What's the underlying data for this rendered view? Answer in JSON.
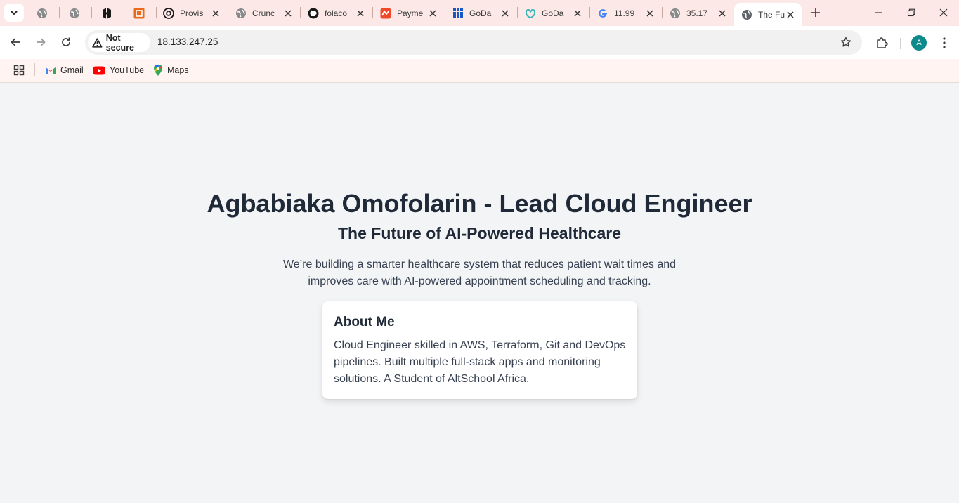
{
  "browser": {
    "tabs": [
      {
        "title": "",
        "icon": "globe-icon"
      },
      {
        "title": "",
        "icon": "globe-icon"
      },
      {
        "title": "",
        "icon": "hashicorp-icon"
      },
      {
        "title": "",
        "icon": "orange-box-icon"
      },
      {
        "title": "Provis",
        "icon": "openai-icon"
      },
      {
        "title": "Crunc",
        "icon": "globe-icon"
      },
      {
        "title": "folaco",
        "icon": "github-icon"
      },
      {
        "title": "Payme",
        "icon": "payment-icon"
      },
      {
        "title": "GoDa",
        "icon": "godaddy-grid-icon"
      },
      {
        "title": "GoDa",
        "icon": "godaddy-icon"
      },
      {
        "title": "11.99",
        "icon": "google-icon"
      },
      {
        "title": "35.17",
        "icon": "globe-icon"
      },
      {
        "title": "The Fu",
        "icon": "globe-icon",
        "active": true
      }
    ],
    "security_label": "Not secure",
    "url": "18.133.247.25",
    "profile_initial": "A",
    "bookmarks": [
      {
        "label": "Gmail",
        "icon": "gmail-icon"
      },
      {
        "label": "YouTube",
        "icon": "youtube-icon"
      },
      {
        "label": "Maps",
        "icon": "maps-icon"
      }
    ]
  },
  "page": {
    "title": "Agbabiaka Omofolarin - Lead Cloud Engineer",
    "subtitle": "The Future of AI-Powered Healthcare",
    "description": "We’re building a smarter healthcare system that reduces patient wait times and improves care with AI-powered appointment scheduling and tracking.",
    "about": {
      "heading": "About Me",
      "text": "Cloud Engineer skilled in AWS, Terraform, Git and DevOps pipelines. Built multiple full-stack apps and monitoring solutions. A Student of AltSchool Africa."
    }
  },
  "colors": {
    "tabstrip": "#fce8e6",
    "bookmarks_bar": "#fff4f2",
    "page_bg": "#f3f4f6",
    "heading": "#1f2937",
    "avatar": "#0f8a8a"
  }
}
